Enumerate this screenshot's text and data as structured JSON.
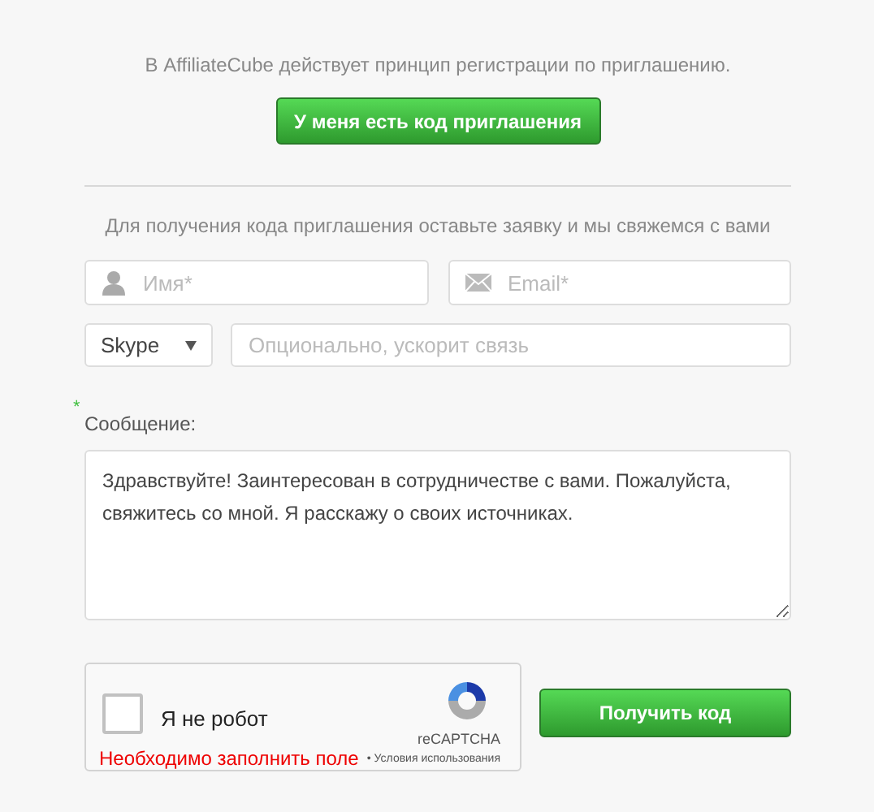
{
  "intro": "В AffiliateCube действует принцип регистрации по приглашению.",
  "invite_button": "У меня есть код приглашения",
  "request_note": "Для получения кода приглашения оставьте заявку и мы свяжемся с вами",
  "name_field": {
    "placeholder": "Имя*"
  },
  "email_field": {
    "placeholder": "Email*"
  },
  "messenger_select": {
    "value": "Skype"
  },
  "contact_field": {
    "placeholder": "Опционально, ускорит связь"
  },
  "message": {
    "required_mark": "*",
    "label": "Сообщение:",
    "value": "Здравствуйте! Заинтересован в сотрудничестве с вами. Пожалуйста, свяжитесь со мной. Я расскажу о своих источниках."
  },
  "captcha": {
    "checked": false,
    "label": "Я не робот",
    "brand": "reCAPTCHA",
    "terms": "• Условия использования",
    "error": "Необходимо заполнить поле"
  },
  "submit_button": "Получить код"
}
